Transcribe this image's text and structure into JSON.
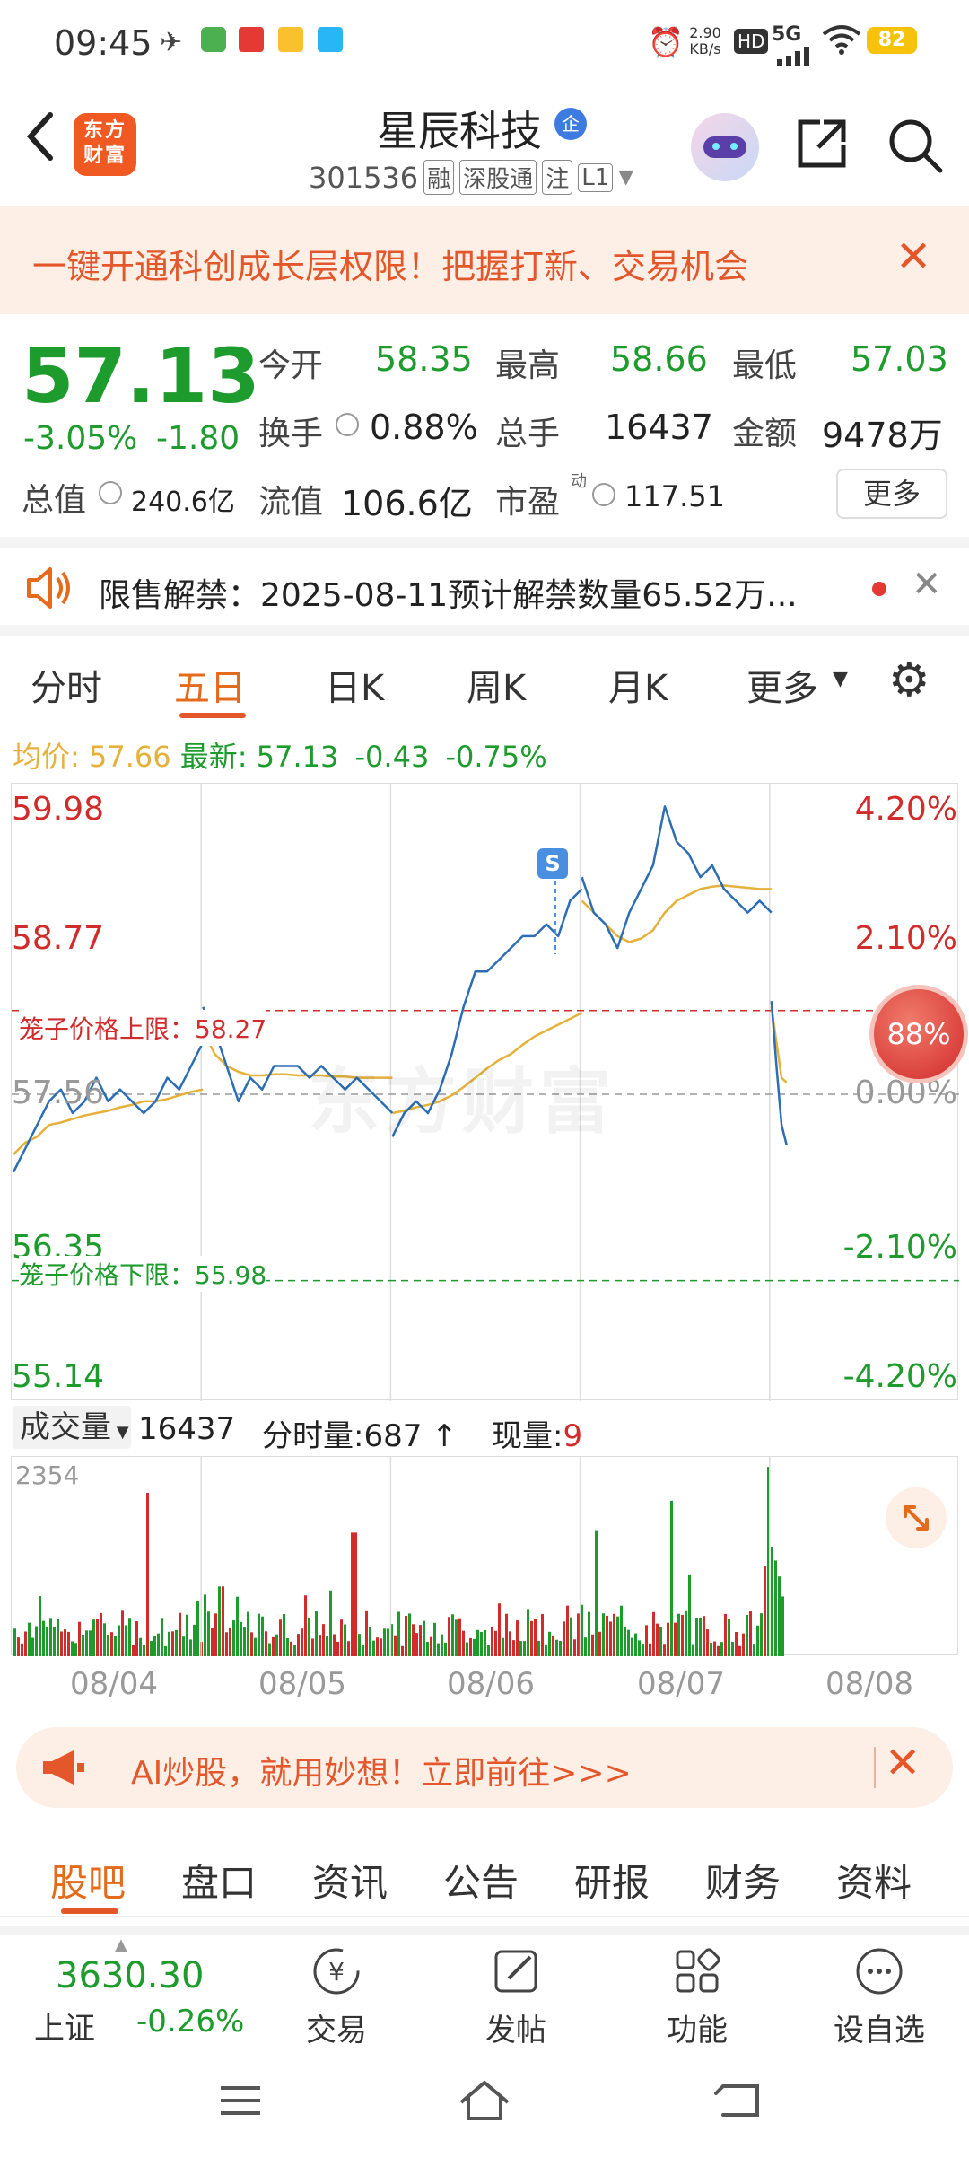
{
  "status": {
    "time": "09:45",
    "speed_value": "2.90",
    "speed_unit": "KB/s",
    "hd": "HD",
    "net": "5G",
    "battery": "82"
  },
  "header": {
    "logo": "东方财富",
    "title": "星辰科技",
    "badge": "企",
    "code": "301536",
    "tags": [
      "融",
      "深股通",
      "注",
      "L1"
    ]
  },
  "promo": {
    "text": "一键开通科创成长层权限！把握打新、交易机会"
  },
  "quote": {
    "price": "57.13",
    "change_pct": "-3.05%",
    "change": "-1.80",
    "open_label": "今开",
    "open": "58.35",
    "high_label": "最高",
    "high": "58.66",
    "low_label": "最低",
    "low": "57.03",
    "turnover_label": "换手",
    "turnover": "0.88%",
    "volume_label": "总手",
    "volume": "16437",
    "amount_label": "金额",
    "amount": "9478万",
    "mcap_label": "总值",
    "mcap": "240.6亿",
    "float_label": "流值",
    "float": "106.6亿",
    "pe_label": "市盈",
    "pe_sup": "动",
    "pe": "117.51",
    "more": "更多"
  },
  "notice": {
    "text": "限售解禁：2025-08-11预计解禁数量65.52万..."
  },
  "tabs": [
    "分时",
    "五日",
    "日K",
    "周K",
    "月K",
    "更多"
  ],
  "active_tab": 1,
  "avg_line": {
    "avg_label": "均价:",
    "avg": "57.66",
    "latest_label": "最新:",
    "latest": "57.13",
    "chg": "-0.43",
    "chg_pct": "-0.75%"
  },
  "chart_data": {
    "type": "line",
    "title": "",
    "y_left_ticks": [
      "59.98",
      "58.77",
      "57.56",
      "56.35",
      "55.14"
    ],
    "y_right_ticks": [
      "4.20%",
      "2.10%",
      "0.00%",
      "-2.10%",
      "-4.20%"
    ],
    "ylim": [
      55.14,
      59.98
    ],
    "x_categories": [
      "08/04",
      "08/05",
      "08/06",
      "08/07",
      "08/08"
    ],
    "upper_limit_label": "笼子价格上限：58.27",
    "upper_limit": 58.27,
    "lower_limit_label": "笼子价格下限：55.98",
    "lower_limit": 55.98,
    "signal_marker": "S",
    "watermark": "东方财富",
    "progress_label": "88%",
    "price_series": [
      {
        "day": "08/04",
        "values": [
          56.9,
          57.1,
          57.3,
          57.5,
          57.6,
          57.4,
          57.5,
          57.7,
          57.5,
          57.6,
          57.5,
          57.4,
          57.5,
          57.7,
          57.6,
          57.8,
          58.0
        ]
      },
      {
        "day": "08/05",
        "values": [
          58.3,
          58.1,
          57.8,
          57.5,
          57.7,
          57.6,
          57.8,
          57.8,
          57.8,
          57.7,
          57.8,
          57.7,
          57.6,
          57.7,
          57.6,
          57.5,
          57.4
        ]
      },
      {
        "day": "08/06",
        "values": [
          57.2,
          57.4,
          57.5,
          57.4,
          57.6,
          57.9,
          58.3,
          58.6,
          58.6,
          58.7,
          58.8,
          58.9,
          58.9,
          59.0,
          58.9,
          59.2,
          59.3
        ]
      },
      {
        "day": "08/07",
        "values": [
          59.4,
          59.1,
          59.0,
          58.8,
          59.1,
          59.3,
          59.5,
          60.0,
          59.7,
          59.6,
          59.4,
          59.5,
          59.3,
          59.2,
          59.1,
          59.2,
          59.1
        ]
      },
      {
        "day": "08/08",
        "values": [
          58.35,
          57.8,
          57.3,
          57.13
        ]
      }
    ],
    "avg_series": [
      {
        "day": "08/04",
        "values": [
          57.05,
          57.15,
          57.2,
          57.3,
          57.32,
          57.35,
          57.38,
          57.4,
          57.42,
          57.45,
          57.47,
          57.5,
          57.5,
          57.52,
          57.55,
          57.58,
          57.6
        ]
      },
      {
        "day": "08/05",
        "values": [
          58.1,
          57.9,
          57.8,
          57.75,
          57.72,
          57.72,
          57.73,
          57.73,
          57.72,
          57.72,
          57.72,
          57.71,
          57.71,
          57.7,
          57.7,
          57.7,
          57.7
        ]
      },
      {
        "day": "08/06",
        "values": [
          57.4,
          57.42,
          57.45,
          57.47,
          57.5,
          57.55,
          57.62,
          57.7,
          57.78,
          57.85,
          57.9,
          57.98,
          58.05,
          58.1,
          58.15,
          58.2,
          58.25
        ]
      },
      {
        "day": "08/07",
        "values": [
          59.2,
          59.1,
          59.0,
          58.9,
          58.85,
          58.88,
          58.95,
          59.1,
          59.2,
          59.25,
          59.3,
          59.32,
          59.33,
          59.32,
          59.31,
          59.3,
          59.3
        ]
      },
      {
        "day": "08/08",
        "values": [
          58.3,
          58.0,
          57.7,
          57.66
        ]
      }
    ],
    "volume_max_label": "2354",
    "volume_ylim": [
      0,
      2354
    ]
  },
  "volume_head": {
    "label": "成交量",
    "total": "16437",
    "tick_label": "分时量:",
    "tick": "687",
    "now_label": "现量:",
    "now": "9"
  },
  "ai_banner": {
    "text": "AI炒股，就用妙想！立即前往>>>"
  },
  "subtabs": [
    "股吧",
    "盘口",
    "资讯",
    "公告",
    "研报",
    "财务",
    "资料"
  ],
  "active_subtab": 0,
  "bottom": {
    "index_value": "3630.30",
    "index_name": "上证",
    "index_change": "-0.26%",
    "items": [
      {
        "label": "交易",
        "icon": "yuan-cycle-icon"
      },
      {
        "label": "发帖",
        "icon": "edit-icon"
      },
      {
        "label": "功能",
        "icon": "grid-icon"
      },
      {
        "label": "设自选",
        "icon": "more-dots-icon"
      }
    ]
  },
  "colors": {
    "up": "#d22b2b",
    "down": "#1e9b2d",
    "accent": "#e4572b",
    "line": "#2c6db5",
    "avg": "#e5b13a"
  }
}
